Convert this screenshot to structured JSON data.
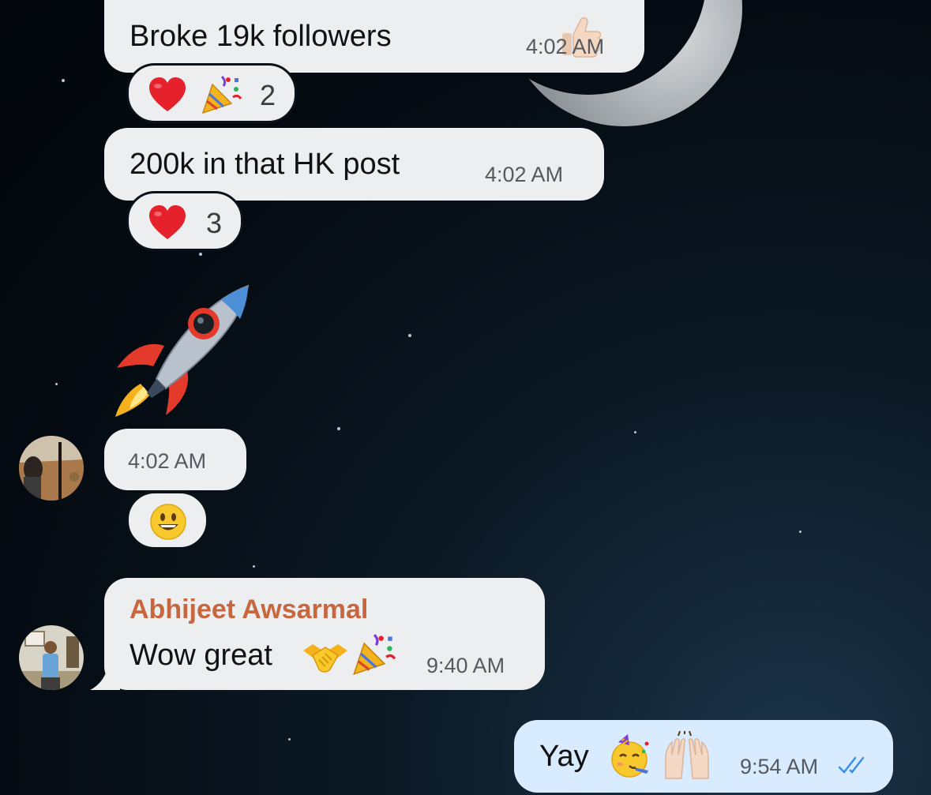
{
  "messages": [
    {
      "text": "Broke 19k followers",
      "time": "4:02 AM",
      "emoji": "thumbs-up-icon",
      "reaction": {
        "emojis": [
          "heart-icon",
          "party-popper-icon"
        ],
        "count": "2"
      }
    },
    {
      "text": "200k in that HK post",
      "time": "4:02 AM",
      "reaction": {
        "emojis": [
          "heart-icon"
        ],
        "count": "3"
      }
    },
    {
      "sticker": "rocket-icon",
      "time": "4:02 AM",
      "reaction": {
        "emojis": [
          "grinning-face-icon"
        ]
      }
    },
    {
      "sender": "Abhijeet Awsarmal",
      "text": "Wow great",
      "time": "9:40 AM",
      "emojis": [
        "handshake-icon",
        "party-popper-icon"
      ]
    },
    {
      "outgoing": true,
      "text": "Yay",
      "time": "9:54 AM",
      "emojis": [
        "partying-face-icon",
        "raising-hands-icon"
      ],
      "status": "read-double-check-icon"
    }
  ],
  "colors": {
    "bubble_incoming": "#eceeef",
    "bubble_outgoing": "#d9ebff",
    "sender_name": "#c8663e",
    "check_read": "#3b8fe8"
  }
}
